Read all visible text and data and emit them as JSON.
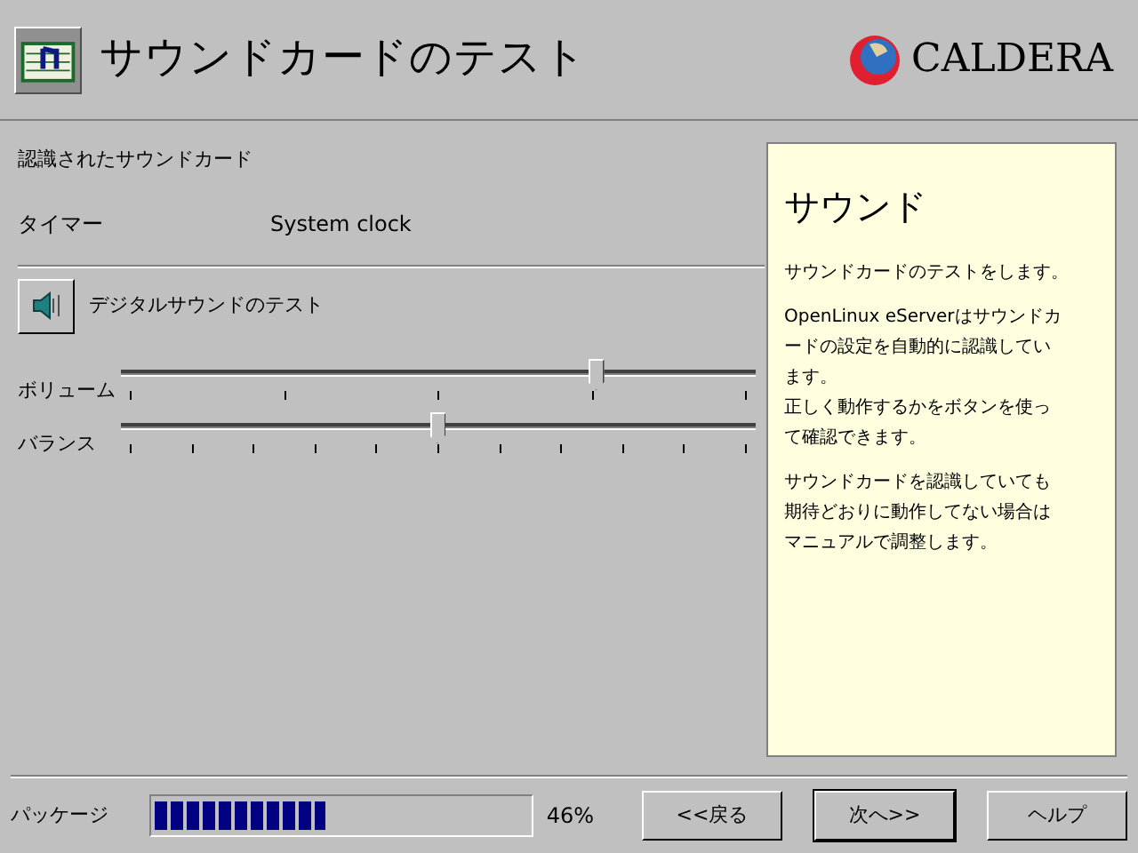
{
  "header": {
    "title": "サウンドカードのテスト",
    "brand": "CALDERA"
  },
  "detected": {
    "heading": "認識されたサウンドカード",
    "label": "タイマー",
    "value": "System clock"
  },
  "test_button": {
    "label": "デジタルサウンドのテスト"
  },
  "sliders": [
    {
      "kind": "volume",
      "label": "ボリューム",
      "level": 0.75
    },
    {
      "kind": "balance",
      "label": "バランス",
      "level": 0.5
    }
  ],
  "help": {
    "title": "サウンド",
    "paragraphs": [
      [
        "サウンドカードのテストをします。"
      ],
      [
        "OpenLinux eServerはサウンドカ",
        "ードの設定を自動的に認識してい",
        "ます。",
        "正しく動作するかをボタンを使っ",
        "て確認できます。"
      ],
      [
        "サウンドカードを認識していても",
        "期待どおりに動作してない場合は",
        "マニュアルで調整します。"
      ]
    ]
  },
  "footer": {
    "progress_label": "パッケージ",
    "progress": {
      "level": 0.46
    },
    "percent": "46%",
    "buttons": [
      {
        "label": "<<戻る",
        "default": false
      },
      {
        "label": "次へ>>",
        "default": true
      },
      {
        "label": "ヘルプ",
        "default": false
      }
    ]
  }
}
